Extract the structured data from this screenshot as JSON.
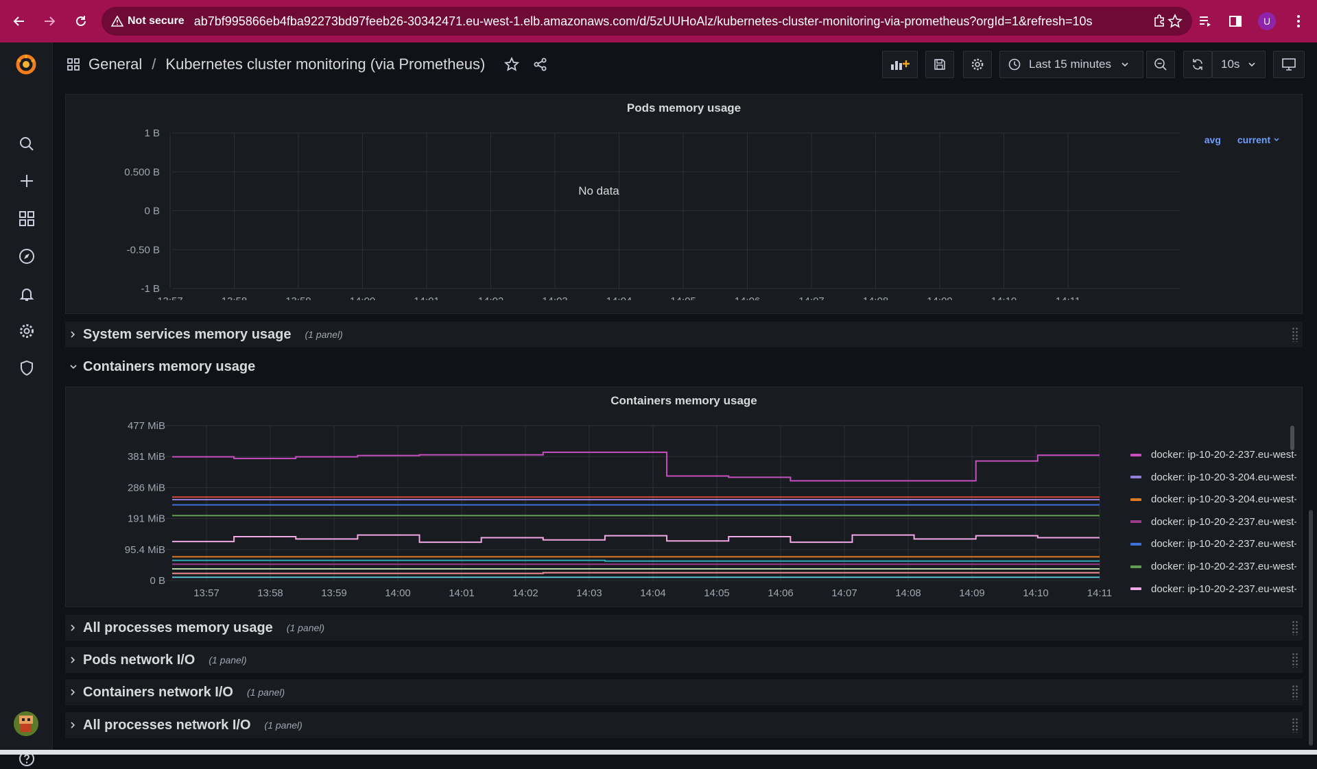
{
  "browser": {
    "security_label": "Not secure",
    "url": "ab7bf995866eb4fba92273bd97feeb26-30342471.eu-west-1.elb.amazonaws.com/d/5zUUHoAlz/kubernetes-cluster-monitoring-via-prometheus?orgId=1&refresh=10s",
    "profile_initial": "U"
  },
  "breadcrumb": {
    "folder": "General",
    "separator": "/",
    "dashboard": "Kubernetes cluster monitoring (via Prometheus)"
  },
  "toolbar": {
    "time_range": "Last 15 minutes",
    "refresh_interval": "10s"
  },
  "pods_panel": {
    "title": "Pods memory usage",
    "no_data": "No data",
    "legend_avg": "avg",
    "legend_current": "current",
    "chart_data": {
      "type": "line",
      "title": "Pods memory usage",
      "y_ticks": [
        "1 B",
        "0.500 B",
        "0 B",
        "-0.50 B",
        "-1 B"
      ],
      "ylim": [
        -1,
        1
      ],
      "x_ticks": [
        "13:57",
        "13:58",
        "13:59",
        "14:00",
        "14:01",
        "14:02",
        "14:03",
        "14:04",
        "14:05",
        "14:06",
        "14:07",
        "14:08",
        "14:09",
        "14:10",
        "14:11"
      ],
      "series": [],
      "grid": true
    }
  },
  "rows": {
    "system_services": {
      "title": "System services memory usage",
      "count": "(1 panel)"
    },
    "containers": {
      "title": "Containers memory usage"
    },
    "all_processes_memory": {
      "title": "All processes memory usage",
      "count": "(1 panel)"
    },
    "pods_network": {
      "title": "Pods network I/O",
      "count": "(1 panel)"
    },
    "containers_network": {
      "title": "Containers network I/O",
      "count": "(1 panel)"
    },
    "all_processes_network": {
      "title": "All processes network I/O",
      "count": "(1 panel)"
    }
  },
  "containers_panel": {
    "title": "Containers memory usage",
    "legend": [
      {
        "label": "docker: ip-10-20-2-237.eu-west-",
        "color": "#c74fc2"
      },
      {
        "label": "docker: ip-10-20-3-204.eu-west-",
        "color": "#8f7fd8"
      },
      {
        "label": "docker: ip-10-20-3-204.eu-west-",
        "color": "#e07a20"
      },
      {
        "label": "docker: ip-10-20-2-237.eu-west-",
        "color": "#9c3b8c"
      },
      {
        "label": "docker: ip-10-20-2-237.eu-west-",
        "color": "#3d71d9"
      },
      {
        "label": "docker: ip-10-20-2-237.eu-west-",
        "color": "#629e51"
      },
      {
        "label": "docker: ip-10-20-2-237.eu-west-",
        "color": "#f2a8e6"
      }
    ],
    "chart_data": {
      "type": "line",
      "title": "Containers memory usage",
      "y_ticks": [
        "477 MiB",
        "381 MiB",
        "286 MiB",
        "191 MiB",
        "95.4 MiB",
        "0 B"
      ],
      "ylim": [
        0,
        477
      ],
      "x_ticks": [
        "13:57",
        "13:58",
        "13:59",
        "14:00",
        "14:01",
        "14:02",
        "14:03",
        "14:04",
        "14:05",
        "14:06",
        "14:07",
        "14:08",
        "14:09",
        "14:10",
        "14:11"
      ],
      "grid": true,
      "series": [
        {
          "name": "docker: ip-10-20-2-237.eu-west-",
          "color": "#c74fc2",
          "values": [
            381,
            376,
            381,
            385,
            387,
            387,
            395,
            395,
            322,
            318,
            307,
            307,
            307,
            368,
            386
          ]
        },
        {
          "name": "docker: ip-10-20-3-204.eu-west-",
          "color": "#d44a3a",
          "values": [
            257,
            257,
            257,
            257,
            257,
            257,
            257,
            257,
            257,
            257,
            257,
            257,
            257,
            257,
            257
          ]
        },
        {
          "name": "docker: ip-10-20-3-204.eu-west-",
          "color": "#8f7fd8",
          "values": [
            249,
            249,
            249,
            249,
            249,
            249,
            249,
            249,
            249,
            249,
            249,
            249,
            249,
            249,
            249
          ]
        },
        {
          "name": "docker: ip-10-20-2-237.eu-west-",
          "color": "#3d71d9",
          "values": [
            233,
            233,
            233,
            233,
            233,
            233,
            233,
            233,
            233,
            233,
            233,
            233,
            233,
            233,
            233
          ]
        },
        {
          "name": "docker: ip-10-20-2-237.eu-west-",
          "color": "#629e51",
          "values": [
            200,
            200,
            200,
            200,
            200,
            200,
            200,
            200,
            200,
            200,
            200,
            200,
            200,
            200,
            200
          ]
        },
        {
          "name": "docker: ip-10-20-2-237.eu-west-",
          "color": "#f2a8e6",
          "values": [
            120,
            135,
            128,
            140,
            118,
            132,
            125,
            138,
            122,
            135,
            118,
            140,
            128,
            138,
            132
          ]
        },
        {
          "name": "docker: ip-10-20-3-204.eu-west-",
          "color": "#e07a20",
          "values": [
            73,
            73,
            73,
            73,
            73,
            73,
            73,
            73,
            73,
            73,
            73,
            73,
            73,
            73,
            73
          ]
        },
        {
          "name": "docker: ip-10-20-2-237.eu-west-",
          "color": "#2bb0c2",
          "values": [
            62,
            62,
            62,
            62,
            62,
            62,
            62,
            60,
            60,
            60,
            60,
            60,
            60,
            60,
            60
          ]
        },
        {
          "name": "docker: ip-10-20-2-237.eu-west-",
          "color": "#9c3b8c",
          "values": [
            50,
            50,
            50,
            50,
            50,
            50,
            50,
            50,
            50,
            50,
            50,
            50,
            50,
            50,
            50
          ]
        },
        {
          "name": "docker: ip-10-20-3-204.eu-west-",
          "color": "#b7dbab",
          "values": [
            36,
            36,
            36,
            36,
            36,
            36,
            36,
            36,
            36,
            36,
            36,
            36,
            36,
            36,
            36
          ]
        },
        {
          "name": "docker: ip-10-20-3-204.eu-west-",
          "color": "#f29191",
          "values": [
            22,
            22,
            22,
            22,
            22,
            22,
            24,
            24,
            24,
            24,
            24,
            24,
            24,
            24,
            24
          ]
        },
        {
          "name": "docker: ip-10-20-2-237.eu-west-",
          "color": "#5ac4d4",
          "values": [
            10,
            10,
            10,
            10,
            10,
            10,
            10,
            10,
            10,
            10,
            10,
            10,
            10,
            10,
            10
          ]
        }
      ]
    }
  }
}
